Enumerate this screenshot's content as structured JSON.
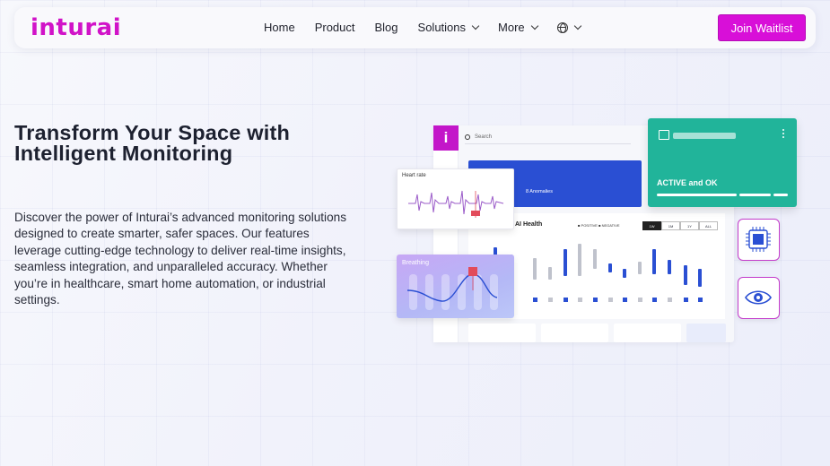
{
  "brand": {
    "logo_text": "inturai",
    "accent": "#d80fd8"
  },
  "nav": {
    "items": [
      {
        "label": "Home"
      },
      {
        "label": "Product"
      },
      {
        "label": "Blog"
      },
      {
        "label": "Solutions"
      },
      {
        "label": "More"
      }
    ],
    "language_icon": "globe-icon",
    "cta_label": "Join Waitlist"
  },
  "hero": {
    "title": "Transform Your Space with Intelligent Monitoring",
    "description": "Discover the power of Inturai’s advanced monitoring solutions designed to create smarter, safer spaces. Our features leverage cutting-edge technology to deliver real-time insights, seamless integration, and unparalleled accuracy. Whether you’re in healthcare, smart home automation, or industrial settings."
  },
  "mockup": {
    "search_placeholder": "Search",
    "anomalies_label": "8 Anomalies",
    "ai_health_title": "AI Health",
    "legend": "■ POSITIVE   ■ NEGATIVE",
    "tabs": [
      "1W",
      "1M",
      "1Y",
      "ALL"
    ],
    "status_title": "ACTIVE and OK",
    "heart_rate_title": "Heart rate",
    "breathing_title": "Breathing",
    "status_color": "#21b49a"
  }
}
